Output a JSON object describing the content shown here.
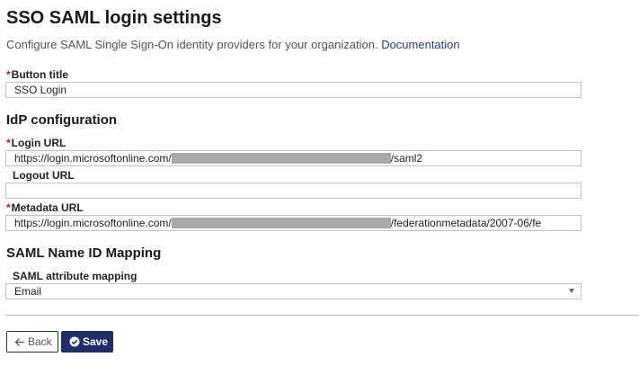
{
  "header": {
    "title": "SSO SAML login settings",
    "description": "Configure SAML Single Sign-On identity providers for your organization.",
    "doc_link": "Documentation"
  },
  "button_title": {
    "label": "Button title",
    "value": "SSO Login"
  },
  "idp": {
    "section_title": "IdP configuration",
    "login_url": {
      "label": "Login URL",
      "prefix": "https://login.microsoftonline.com/",
      "suffix": "/saml2"
    },
    "logout_url": {
      "label": "Logout URL",
      "value": ""
    },
    "metadata_url": {
      "label": "Metadata URL",
      "prefix": "https://login.microsoftonline.com/",
      "suffix": "/federationmetadata/2007-06/fe"
    }
  },
  "mapping": {
    "section_title": "SAML Name ID Mapping",
    "label": "SAML attribute mapping",
    "selected": "Email"
  },
  "actions": {
    "back_label": "Back",
    "save_label": "Save"
  },
  "colors": {
    "accent": "#1f2d6b",
    "required": "#c8102e",
    "link": "#2a3d8f"
  },
  "icons": {
    "back": "arrow-left-icon",
    "save": "check-circle-icon",
    "select": "chevron-down-icon"
  }
}
